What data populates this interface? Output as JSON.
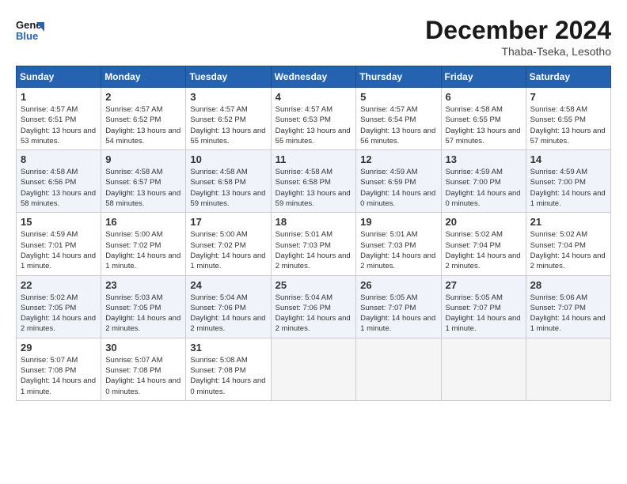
{
  "logo": {
    "line1": "General",
    "line2": "Blue"
  },
  "title": "December 2024",
  "subtitle": "Thaba-Tseka, Lesotho",
  "weekdays": [
    "Sunday",
    "Monday",
    "Tuesday",
    "Wednesday",
    "Thursday",
    "Friday",
    "Saturday"
  ],
  "weeks": [
    [
      {
        "day": "1",
        "info": "Sunrise: 4:57 AM\nSunset: 6:51 PM\nDaylight: 13 hours\nand 53 minutes."
      },
      {
        "day": "2",
        "info": "Sunrise: 4:57 AM\nSunset: 6:52 PM\nDaylight: 13 hours\nand 54 minutes."
      },
      {
        "day": "3",
        "info": "Sunrise: 4:57 AM\nSunset: 6:52 PM\nDaylight: 13 hours\nand 55 minutes."
      },
      {
        "day": "4",
        "info": "Sunrise: 4:57 AM\nSunset: 6:53 PM\nDaylight: 13 hours\nand 55 minutes."
      },
      {
        "day": "5",
        "info": "Sunrise: 4:57 AM\nSunset: 6:54 PM\nDaylight: 13 hours\nand 56 minutes."
      },
      {
        "day": "6",
        "info": "Sunrise: 4:58 AM\nSunset: 6:55 PM\nDaylight: 13 hours\nand 57 minutes."
      },
      {
        "day": "7",
        "info": "Sunrise: 4:58 AM\nSunset: 6:55 PM\nDaylight: 13 hours\nand 57 minutes."
      }
    ],
    [
      {
        "day": "8",
        "info": "Sunrise: 4:58 AM\nSunset: 6:56 PM\nDaylight: 13 hours\nand 58 minutes."
      },
      {
        "day": "9",
        "info": "Sunrise: 4:58 AM\nSunset: 6:57 PM\nDaylight: 13 hours\nand 58 minutes."
      },
      {
        "day": "10",
        "info": "Sunrise: 4:58 AM\nSunset: 6:58 PM\nDaylight: 13 hours\nand 59 minutes."
      },
      {
        "day": "11",
        "info": "Sunrise: 4:58 AM\nSunset: 6:58 PM\nDaylight: 13 hours\nand 59 minutes."
      },
      {
        "day": "12",
        "info": "Sunrise: 4:59 AM\nSunset: 6:59 PM\nDaylight: 14 hours\nand 0 minutes."
      },
      {
        "day": "13",
        "info": "Sunrise: 4:59 AM\nSunset: 7:00 PM\nDaylight: 14 hours\nand 0 minutes."
      },
      {
        "day": "14",
        "info": "Sunrise: 4:59 AM\nSunset: 7:00 PM\nDaylight: 14 hours\nand 1 minute."
      }
    ],
    [
      {
        "day": "15",
        "info": "Sunrise: 4:59 AM\nSunset: 7:01 PM\nDaylight: 14 hours\nand 1 minute."
      },
      {
        "day": "16",
        "info": "Sunrise: 5:00 AM\nSunset: 7:02 PM\nDaylight: 14 hours\nand 1 minute."
      },
      {
        "day": "17",
        "info": "Sunrise: 5:00 AM\nSunset: 7:02 PM\nDaylight: 14 hours\nand 1 minute."
      },
      {
        "day": "18",
        "info": "Sunrise: 5:01 AM\nSunset: 7:03 PM\nDaylight: 14 hours\nand 2 minutes."
      },
      {
        "day": "19",
        "info": "Sunrise: 5:01 AM\nSunset: 7:03 PM\nDaylight: 14 hours\nand 2 minutes."
      },
      {
        "day": "20",
        "info": "Sunrise: 5:02 AM\nSunset: 7:04 PM\nDaylight: 14 hours\nand 2 minutes."
      },
      {
        "day": "21",
        "info": "Sunrise: 5:02 AM\nSunset: 7:04 PM\nDaylight: 14 hours\nand 2 minutes."
      }
    ],
    [
      {
        "day": "22",
        "info": "Sunrise: 5:02 AM\nSunset: 7:05 PM\nDaylight: 14 hours\nand 2 minutes."
      },
      {
        "day": "23",
        "info": "Sunrise: 5:03 AM\nSunset: 7:05 PM\nDaylight: 14 hours\nand 2 minutes."
      },
      {
        "day": "24",
        "info": "Sunrise: 5:04 AM\nSunset: 7:06 PM\nDaylight: 14 hours\nand 2 minutes."
      },
      {
        "day": "25",
        "info": "Sunrise: 5:04 AM\nSunset: 7:06 PM\nDaylight: 14 hours\nand 2 minutes."
      },
      {
        "day": "26",
        "info": "Sunrise: 5:05 AM\nSunset: 7:07 PM\nDaylight: 14 hours\nand 1 minute."
      },
      {
        "day": "27",
        "info": "Sunrise: 5:05 AM\nSunset: 7:07 PM\nDaylight: 14 hours\nand 1 minute."
      },
      {
        "day": "28",
        "info": "Sunrise: 5:06 AM\nSunset: 7:07 PM\nDaylight: 14 hours\nand 1 minute."
      }
    ],
    [
      {
        "day": "29",
        "info": "Sunrise: 5:07 AM\nSunset: 7:08 PM\nDaylight: 14 hours\nand 1 minute."
      },
      {
        "day": "30",
        "info": "Sunrise: 5:07 AM\nSunset: 7:08 PM\nDaylight: 14 hours\nand 0 minutes."
      },
      {
        "day": "31",
        "info": "Sunrise: 5:08 AM\nSunset: 7:08 PM\nDaylight: 14 hours\nand 0 minutes."
      },
      {
        "day": "",
        "info": ""
      },
      {
        "day": "",
        "info": ""
      },
      {
        "day": "",
        "info": ""
      },
      {
        "day": "",
        "info": ""
      }
    ]
  ]
}
